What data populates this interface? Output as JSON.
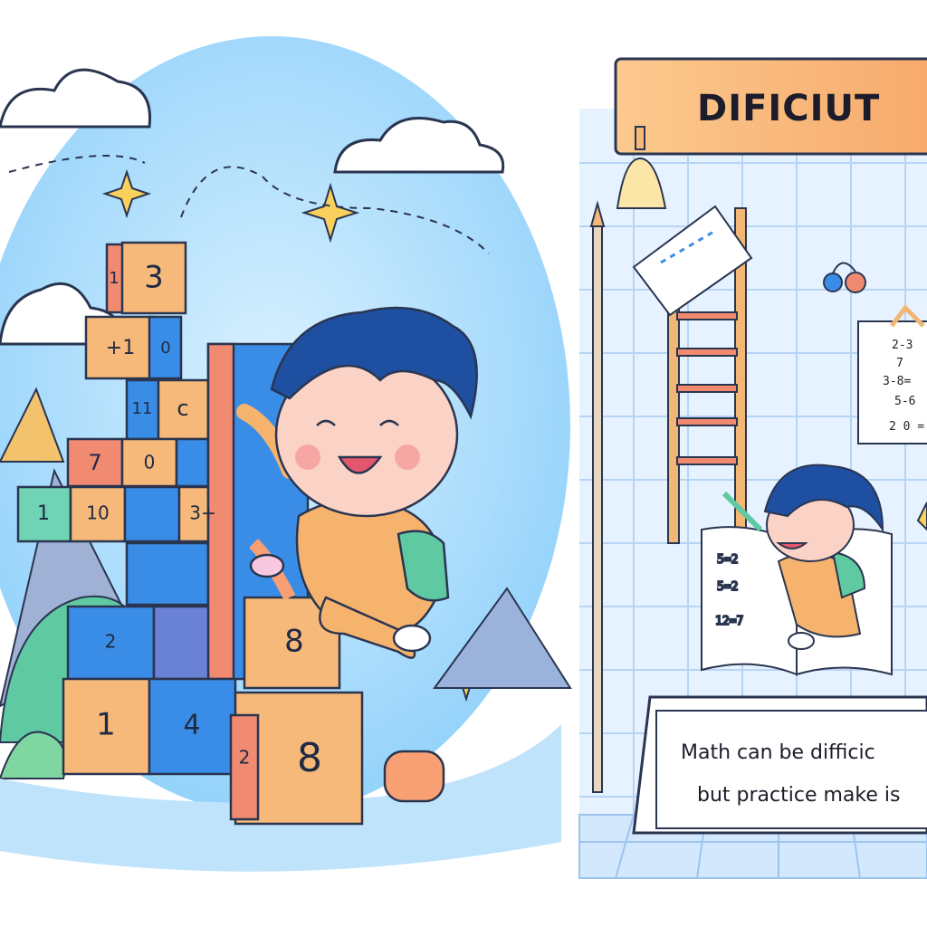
{
  "banner": {
    "title": "DIFICIUT"
  },
  "sign": {
    "line1": "Math can be difficic",
    "line2": "but practice make is"
  },
  "blocks": [
    {
      "id": "b1",
      "label": "1"
    },
    {
      "id": "b2",
      "label": "3"
    },
    {
      "id": "b3",
      "label": "+1"
    },
    {
      "id": "b4",
      "label": "0"
    },
    {
      "id": "b5",
      "label": "11"
    },
    {
      "id": "b6",
      "label": "c"
    },
    {
      "id": "b7",
      "label": "7"
    },
    {
      "id": "b8",
      "label": "0"
    },
    {
      "id": "b9",
      "label": "1"
    },
    {
      "id": "b10",
      "label": "10"
    },
    {
      "id": "b11",
      "label": "3+"
    },
    {
      "id": "b12",
      "label": "2"
    },
    {
      "id": "b13",
      "label": "8"
    },
    {
      "id": "b14",
      "label": "1"
    },
    {
      "id": "b15",
      "label": "4"
    },
    {
      "id": "b16",
      "label": "2"
    },
    {
      "id": "b17",
      "label": "8"
    }
  ],
  "notepad": {
    "lines": [
      "2-3",
      "7",
      "3-8=",
      "5-6",
      "2 0 ="
    ]
  },
  "book": {
    "lines": [
      "5=2",
      "5=2",
      "12=7"
    ]
  },
  "colors": {
    "sky": "#a9dcfb",
    "orange_block": "#f6b979",
    "blue_block": "#3a8de6",
    "banner": "#fbc488"
  }
}
